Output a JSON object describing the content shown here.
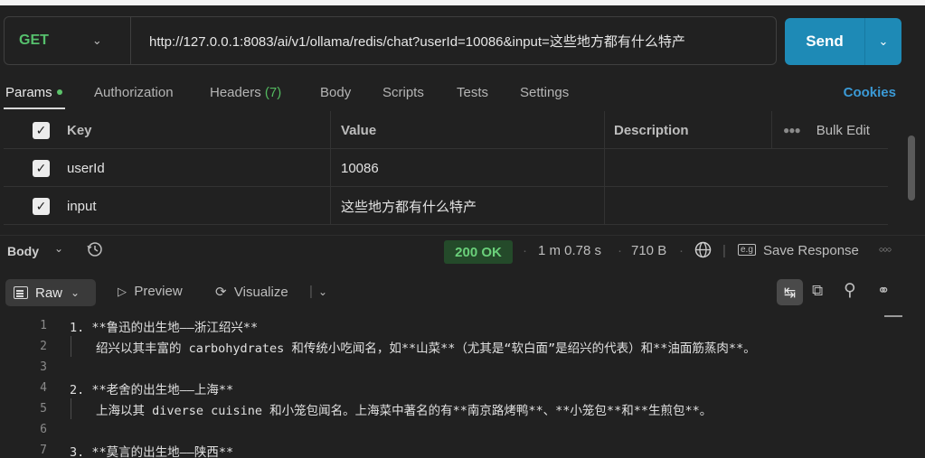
{
  "request": {
    "method": "GET",
    "url": "http://127.0.0.1:8083/ai/v1/ollama/redis/chat?userId=10086&input=这些地方都有什么特产",
    "send_label": "Send"
  },
  "tabs": {
    "params": "Params",
    "authorization": "Authorization",
    "headers": "Headers",
    "headers_count": "(7)",
    "body": "Body",
    "scripts": "Scripts",
    "tests": "Tests",
    "settings": "Settings",
    "cookies": "Cookies"
  },
  "params_table": {
    "headers": {
      "key": "Key",
      "value": "Value",
      "description": "Description",
      "bulk_edit": "Bulk Edit"
    },
    "rows": [
      {
        "key": "userId",
        "value": "10086",
        "checked": true
      },
      {
        "key": "input",
        "value": "这些地方都有什么特产",
        "checked": true
      }
    ]
  },
  "response": {
    "body_label": "Body",
    "status": "200 OK",
    "time": "1 m 0.78 s",
    "size": "710 B",
    "save_response": "Save Response",
    "view_mode": "Raw",
    "preview": "Preview",
    "visualize": "Visualize"
  },
  "code_lines": [
    {
      "n": "1",
      "text": "1. **鲁迅的出生地——浙江绍兴**",
      "indent": false
    },
    {
      "n": "2",
      "text": "绍兴以其丰富的 carbohydrates 和传统小吃闻名，如**山菜**（尤其是“软白面”是绍兴的代表）和**油面筋蒸肉**。",
      "indent": true
    },
    {
      "n": "3",
      "text": "",
      "indent": false
    },
    {
      "n": "4",
      "text": "2. **老舍的出生地——上海**",
      "indent": false
    },
    {
      "n": "5",
      "text": "上海以其 diverse cuisine 和小笼包闻名。上海菜中著名的有**南京路烤鸭**、**小笼包**和**生煎包**。",
      "indent": true
    },
    {
      "n": "6",
      "text": "",
      "indent": false
    },
    {
      "n": "7",
      "text": "3. **莫言的出生地——陕西**",
      "indent": false
    }
  ],
  "colors": {
    "accent": "#1e8ab6",
    "method_get": "#56c06d",
    "status_ok": "#6ad07a",
    "cookies_link": "#3b9ad6"
  }
}
